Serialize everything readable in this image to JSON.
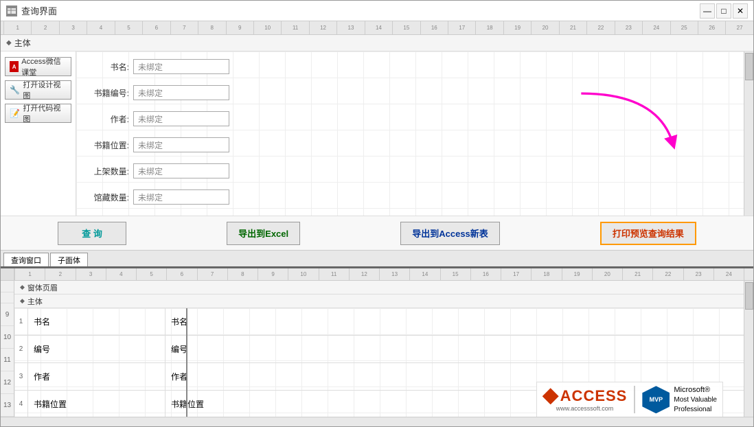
{
  "window": {
    "title": "查询界面",
    "icon": "🗃"
  },
  "title_controls": {
    "minimize": "—",
    "maximize": "□",
    "close": "✕"
  },
  "ruler": {
    "marks": [
      "1",
      "2",
      "3",
      "4",
      "5",
      "6",
      "7",
      "8",
      "9",
      "10",
      "11",
      "12",
      "13",
      "14",
      "15",
      "16",
      "17",
      "18",
      "19",
      "20",
      "21",
      "22",
      "23",
      "24",
      "25",
      "26",
      "27"
    ]
  },
  "upper_section": {
    "header": "主体",
    "sidebar": {
      "access_btn": "Access微信课堂",
      "design_btn": "打开设计视图",
      "code_btn": "打开代码视图"
    },
    "form_fields": [
      {
        "label": "书名:",
        "value": "未绑定"
      },
      {
        "label": "书籍编号:",
        "value": "未绑定"
      },
      {
        "label": "作者:",
        "value": "未绑定"
      },
      {
        "label": "书籍位置:",
        "value": "未绑定"
      },
      {
        "label": "上架数量:",
        "value": "未绑定"
      },
      {
        "label": "馆藏数量:",
        "value": "未绑定"
      }
    ],
    "action_buttons": [
      {
        "label": "查 询",
        "style": "cyan"
      },
      {
        "label": "导出到Excel",
        "style": "dark-green"
      },
      {
        "label": "导出到Access新表",
        "style": "dark-blue"
      },
      {
        "label": "打印预览查询结果",
        "style": "orange-border"
      }
    ],
    "tabs": [
      {
        "label": "查询窗口"
      },
      {
        "label": "子面体"
      }
    ]
  },
  "lower_section": {
    "page_header": "窗体页眉",
    "main_header": "主体",
    "ruler_marks": [
      "1",
      "2",
      "3",
      "4",
      "5",
      "6",
      "7",
      "8",
      "9",
      "10",
      "11",
      "12",
      "13",
      "14",
      "15",
      "16",
      "17",
      "18",
      "19",
      "20",
      "21",
      "22",
      "23",
      "24"
    ],
    "rows": [
      {
        "num": "1",
        "label": "书名",
        "value": "书名"
      },
      {
        "num": "2",
        "label": "编号",
        "value": "编号"
      },
      {
        "num": "3",
        "label": "作者",
        "value": "作者"
      },
      {
        "num": "4",
        "label": "书籍位置",
        "value": "书籍位置"
      }
    ]
  },
  "watermark": {
    "logo_text": "ACCESS",
    "logo_url": "www.accesssoft.com",
    "mvp_label": "MVP",
    "mvp_desc": "Microsoft®\nMost Valuable\nProfessional"
  }
}
